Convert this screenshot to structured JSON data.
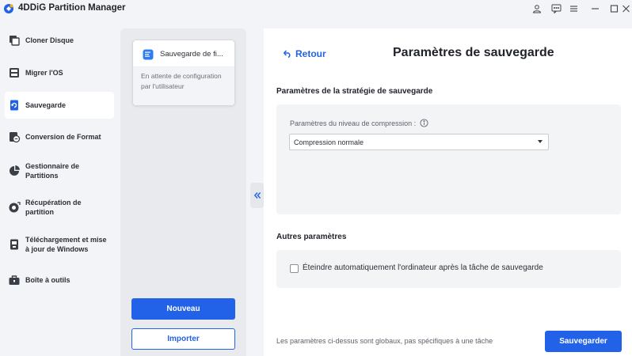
{
  "app": {
    "title": "4DDiG Partition Manager"
  },
  "titlebar_icons": [
    "user-icon",
    "feedback-icon",
    "menu-icon",
    "minimize-icon",
    "maximize-icon",
    "close-icon"
  ],
  "sidebar": {
    "items": [
      {
        "label": "Cloner Disque",
        "icon": "clone-disk-icon",
        "active": false
      },
      {
        "label": "Migrer l'OS",
        "icon": "migrate-os-icon",
        "active": false
      },
      {
        "label": "Sauvegarde",
        "icon": "backup-icon",
        "active": true
      },
      {
        "label": "Conversion de Format",
        "icon": "convert-format-icon",
        "active": false
      },
      {
        "label": "Gestionnaire de Partitions",
        "icon": "partition-manager-icon",
        "active": false
      },
      {
        "label": "Récupération de partition",
        "icon": "partition-recovery-icon",
        "active": false
      },
      {
        "label": "Téléchargement et mise à jour de Windows",
        "icon": "windows-download-icon",
        "active": false
      },
      {
        "label": "Boîte à outils",
        "icon": "toolbox-icon",
        "active": false
      }
    ]
  },
  "task_panel": {
    "card": {
      "title": "Sauvegarde de fi...",
      "status": "En attente de configuration par l'utilisateur"
    },
    "new_label": "Nouveau",
    "import_label": "Importer"
  },
  "main": {
    "back_label": "Retour",
    "title": "Paramètres de sauvegarde",
    "strategy_title": "Paramètres de la stratégie de sauvegarde",
    "compression_label": "Paramètres du niveau de compression :",
    "compression_value": "Compression normale",
    "other_title": "Autres paramètres",
    "shutdown_label": "Éteindre automatiquement l'ordinateur après la tâche de sauvegarde",
    "shutdown_checked": false,
    "footer_note": "Les paramètres ci-dessus sont globaux, pas spécifiques à une tâche",
    "save_label": "Sauvegarder"
  },
  "colors": {
    "accent": "#2262e8",
    "background": "#f3f4f8"
  }
}
